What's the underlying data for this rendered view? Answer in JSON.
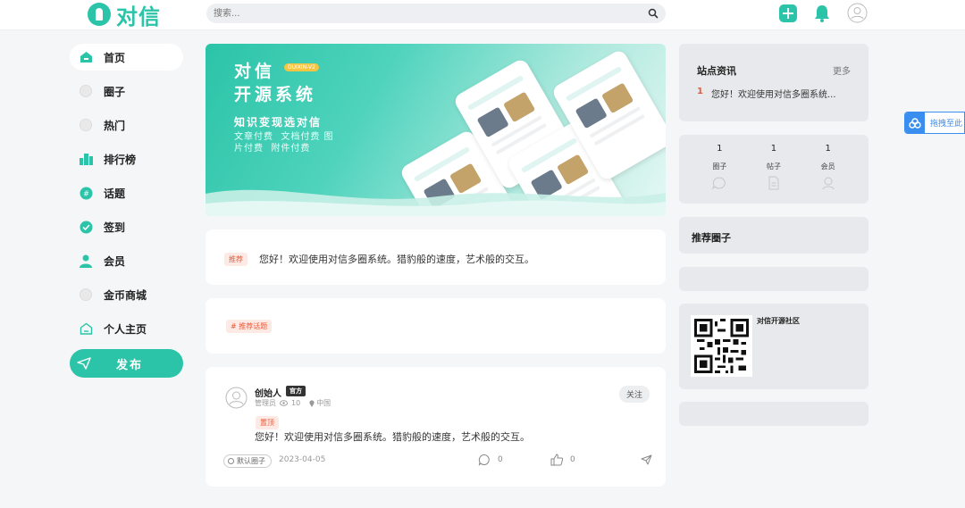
{
  "header": {
    "logo_text": "对信",
    "search_placeholder": "搜索...",
    "icons": [
      "search-icon",
      "add-icon",
      "bell-icon",
      "user-avatar-icon"
    ]
  },
  "sidebar": {
    "items": [
      {
        "label": "首页",
        "icon": "home-icon",
        "active": true
      },
      {
        "label": "圈子",
        "icon": "broken-image-icon"
      },
      {
        "label": "热门",
        "icon": "broken-image-icon"
      },
      {
        "label": "排行榜",
        "icon": "ranking-icon"
      },
      {
        "label": "话题",
        "icon": "topic-icon"
      },
      {
        "label": "签到",
        "icon": "checkin-icon"
      },
      {
        "label": "会员",
        "icon": "member-icon"
      },
      {
        "label": "金币商城",
        "icon": "broken-image-icon"
      },
      {
        "label": "个人主页",
        "icon": "profile-home-icon"
      }
    ],
    "publish_label": "发布"
  },
  "banner": {
    "title_line1": "对信",
    "title_line2": "开源系统",
    "version": "DUIXIN-V2",
    "subtitle": "知识变现选对信",
    "tags": [
      "文章付费",
      "文档付费",
      "图片付费",
      "附件付费"
    ]
  },
  "notice": {
    "tag": "推荐",
    "text": "您好！欢迎使用对信多圈系统。猎豹般的速度，艺术般的交互。"
  },
  "topic": {
    "tag": "# 推荐话题"
  },
  "post": {
    "author": "创始人",
    "level": "官方",
    "role": "管理员",
    "views": "10",
    "location": "中国",
    "follow_label": "关注",
    "pin_tag": "置顶",
    "text": "您好！欢迎使用对信多圈系统。猎豹般的速度，艺术般的交互。",
    "circle": "默认圈子",
    "date": "2023-04-05",
    "comments": "0",
    "likes": "0"
  },
  "right": {
    "site_news_title": "站点资讯",
    "site_news_more": "更多",
    "news_items": [
      {
        "num": "1",
        "text": "您好！欢迎使用对信多圈系统..."
      }
    ],
    "stats": [
      {
        "value": "1",
        "label": "圈子",
        "icon": "circle-icon"
      },
      {
        "value": "1",
        "label": "帖子",
        "icon": "document-icon"
      },
      {
        "value": "1",
        "label": "会员",
        "icon": "member-icon"
      }
    ],
    "recommend_title": "推荐圈子",
    "qr_name": "对信开源社区"
  },
  "float_button": {
    "label": "拖拽至此"
  },
  "colors": {
    "brand": "#2bc4a8",
    "accent_red": "#e85a3a",
    "float_blue": "#3a8ef0"
  }
}
